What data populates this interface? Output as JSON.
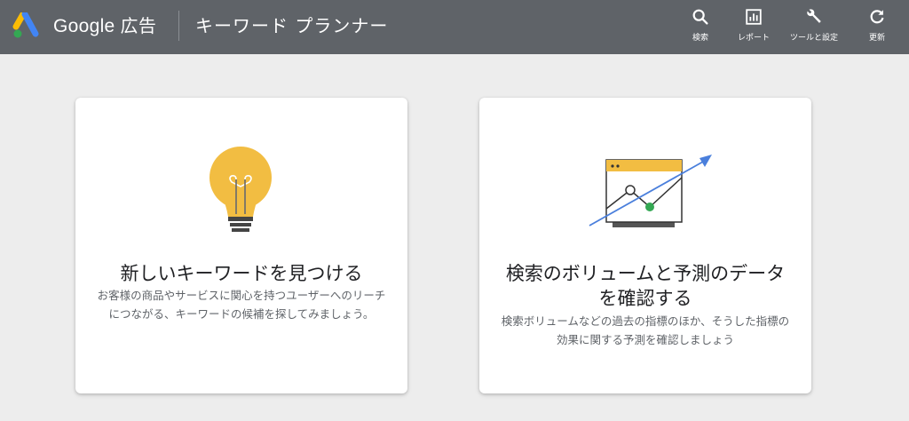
{
  "header": {
    "brand_name": "Google",
    "brand_suffix": "広告",
    "tool_title": "キーワード プランナー",
    "actions": [
      {
        "label": "検索",
        "icon": "search-icon"
      },
      {
        "label": "レポート",
        "icon": "report-icon"
      },
      {
        "label": "ツールと設定",
        "icon": "wrench-icon"
      },
      {
        "label": "更新",
        "icon": "refresh-icon"
      }
    ]
  },
  "cards": [
    {
      "title": "新しいキーワードを見つける",
      "description": "お客様の商品やサービスに関心を持つユーザーへのリーチにつながる、キーワードの候補を探してみましょう。",
      "illustration": "lightbulb-icon"
    },
    {
      "title": "検索のボリュームと予測のデータを確認する",
      "description": "検索ボリュームなどの過去の指標のほか、そうした指標の効果に関する予測を確認しましょう",
      "illustration": "chart-trend-icon"
    }
  ],
  "colors": {
    "topbar": "#5f6368",
    "page_bg": "#ededed",
    "bulb_yellow": "#f2bd42",
    "arrow_blue": "#4a7fdc",
    "point_green": "#34a853",
    "logo_blue": "#4285f4",
    "logo_yellow": "#fbbc04",
    "logo_green": "#34a853"
  }
}
